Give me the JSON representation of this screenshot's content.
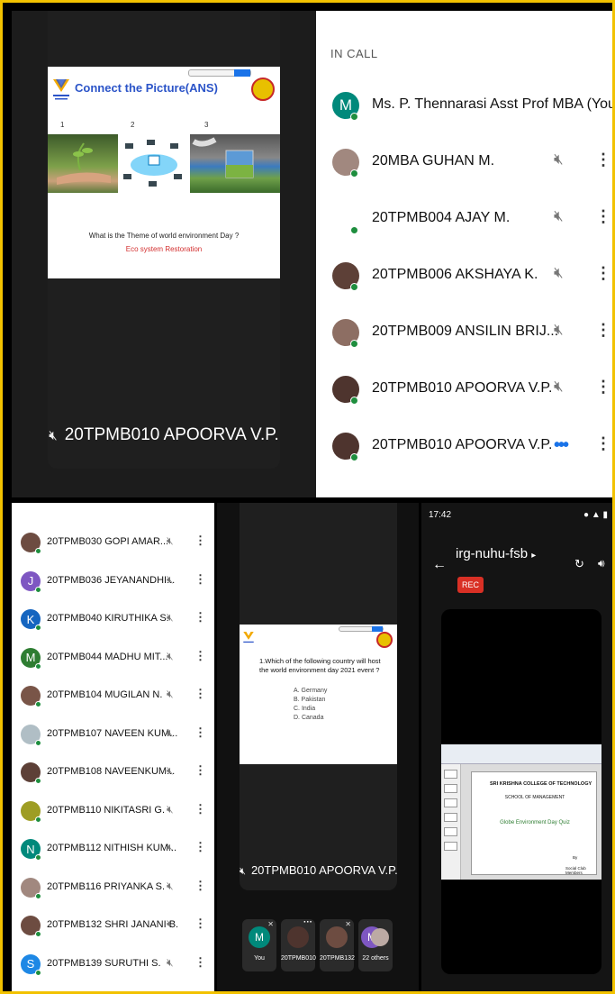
{
  "top_video": {
    "slide_title": "Connect the Picture(ANS)",
    "numbers": [
      "1",
      "2",
      "3"
    ],
    "question": "What is the Theme of world environment  Day ?",
    "answer": "Eco system  Restoration",
    "speaker_name": "20TPMB010 APOORVA V.P."
  },
  "in_call": {
    "header": "IN CALL",
    "participants": [
      {
        "name": "Ms. P. Thennarasi Asst Prof MBA (You)",
        "initial": "M",
        "color": "#00897b"
      },
      {
        "name": "20MBA GUHAN M.",
        "initial": "",
        "color": "#a1887f"
      },
      {
        "name": "20TPMB004 AJAY M.",
        "initial": "",
        "color": "#ffffff"
      },
      {
        "name": "20TPMB006 AKSHAYA K.",
        "initial": "",
        "color": "#5d4037"
      },
      {
        "name": "20TPMB009 ANSILIN BRIJ...",
        "initial": "",
        "color": "#8d6e63"
      },
      {
        "name": "20TPMB010 APOORVA V.P.",
        "initial": "",
        "color": "#4e342e"
      },
      {
        "name": "20TPMB010 APOORVA V.P.",
        "initial": "",
        "color": "#4e342e"
      }
    ]
  },
  "list2": {
    "participants": [
      {
        "name": "20TPMB030 GOPI AMAR...",
        "initial": "",
        "color": "#6d4c41"
      },
      {
        "name": "20TPMB036 JEYANANDHI...",
        "initial": "J",
        "color": "#7e57c2"
      },
      {
        "name": "20TPMB040 KIRUTHIKA S.",
        "initial": "K",
        "color": "#1565c0"
      },
      {
        "name": "20TPMB044 MADHU MIT...",
        "initial": "M",
        "color": "#2e7d32"
      },
      {
        "name": "20TPMB104 MUGILAN N.",
        "initial": "",
        "color": "#795548"
      },
      {
        "name": "20TPMB107 NAVEEN KUM...",
        "initial": "",
        "color": "#b0bec5"
      },
      {
        "name": "20TPMB108 NAVEENKUM...",
        "initial": "",
        "color": "#5d4037"
      },
      {
        "name": "20TPMB110 NIKITASRI G.",
        "initial": "",
        "color": "#9e9d24"
      },
      {
        "name": "20TPMB112 NITHISH KUM...",
        "initial": "N",
        "color": "#00897b"
      },
      {
        "name": "20TPMB116 PRIYANKA S.",
        "initial": "",
        "color": "#a1887f"
      },
      {
        "name": "20TPMB132 SHRI JANANI B.",
        "initial": "",
        "color": "#6d4c41"
      },
      {
        "name": "20TPMB139 SURUTHI S.",
        "initial": "S",
        "color": "#1e88e5"
      }
    ]
  },
  "mid_video": {
    "question": "1.Which of the following country will host the world environment day 2021 event ?",
    "options": [
      "A. Germany",
      "B. Pakistan",
      "C. India",
      "D. Canada"
    ],
    "speaker_name": "20TPMB010 APOORVA V.P.",
    "strip": [
      {
        "label": "You",
        "initial": "M",
        "color": "#00897b"
      },
      {
        "label": "20TPMB010",
        "initial": "",
        "color": "#4e342e"
      },
      {
        "label": "20TPMB132",
        "initial": "",
        "color": "#6d4c41"
      },
      {
        "label": "22 others",
        "initial": "M",
        "color": "#7e57c2"
      }
    ]
  },
  "phone": {
    "time": "17:42",
    "meeting_code": "irg-nuhu-fsb",
    "rec_label": "REC",
    "slide_college": "SRI KRISHNA COLLEGE OF TECHNOLOGY",
    "slide_school": "SCHOOL OF MANAGEMENT",
    "slide_title": "Globe Environment Day Quiz",
    "slide_by": "By",
    "slide_members": "Social Club Members"
  },
  "icons": {
    "mic_off": "mic-off-icon",
    "more": "more-vert-icon",
    "back": "back-arrow-icon",
    "switch_camera": "switch-camera-icon",
    "speaker": "speaker-icon"
  },
  "colors": {
    "frame_border": "#f2c200",
    "online_dot": "#1e8e3e",
    "rec_red": "#d93025",
    "slide_title_blue": "#2b54c8",
    "answer_red": "#d32f2f"
  }
}
